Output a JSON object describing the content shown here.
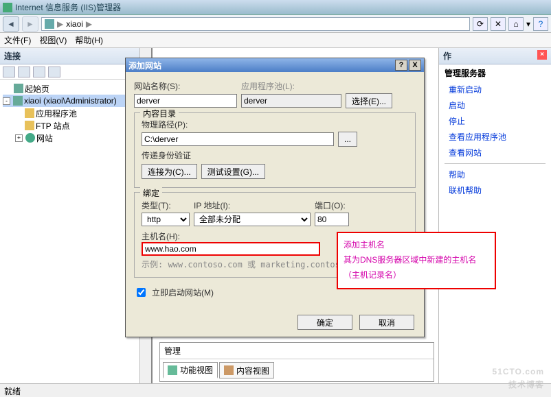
{
  "window": {
    "title": "Internet 信息服务 (IIS)管理器"
  },
  "nav": {
    "crumb1": "xiaoi",
    "sep": "▶"
  },
  "menu": {
    "file": "文件(F)",
    "view": "视图(V)",
    "help": "帮助(H)"
  },
  "conn": {
    "title": "连接",
    "start": "起始页",
    "server": "xiaoi (xiaoi\\Administrator)",
    "pool": "应用程序池",
    "ftp": "FTP 站点",
    "sites": "网站"
  },
  "tabs": {
    "header": "管理",
    "features": "功能视图",
    "content": "内容视图"
  },
  "actions": {
    "title": "作",
    "cat1": "管理服务器",
    "restart": "重新启动",
    "start": "启动",
    "stop": "停止",
    "viewPool": "查看应用程序池",
    "viewSite": "查看网站",
    "help": "帮助",
    "online": "联机帮助"
  },
  "status": {
    "ready": "就绪"
  },
  "dialog": {
    "title": "添加网站",
    "siteNameLbl": "网站名称(S):",
    "siteName": "derver",
    "appPoolLbl": "应用程序池(L):",
    "appPool": "derver",
    "selectBtn": "选择(E)...",
    "contentGrp": "内容目录",
    "pathLbl": "物理路径(P):",
    "path": "C:\\derver",
    "browseBtn": "...",
    "passthrough": "传递身份验证",
    "connectAs": "连接为(C)...",
    "testBtn": "测试设置(G)...",
    "bindGrp": "绑定",
    "typeLbl": "类型(T):",
    "type": "http",
    "ipLbl": "IP 地址(I):",
    "ip": "全部未分配",
    "portLbl": "端口(O):",
    "port": "80",
    "hostLbl": "主机名(H):",
    "host": "www.hao.com",
    "example": "示例: www.contoso.com 或 marketing.contoso.com",
    "autostart": "立即启动网站(M)",
    "ok": "确定",
    "cancel": "取消",
    "help": "?",
    "close": "X"
  },
  "annot": {
    "l1": "添加主机名",
    "l2": "其为DNS服务器区域中新建的主机名（主机记录名）"
  },
  "watermark": {
    "big": "51CTO.com",
    "small": "技术博客"
  }
}
